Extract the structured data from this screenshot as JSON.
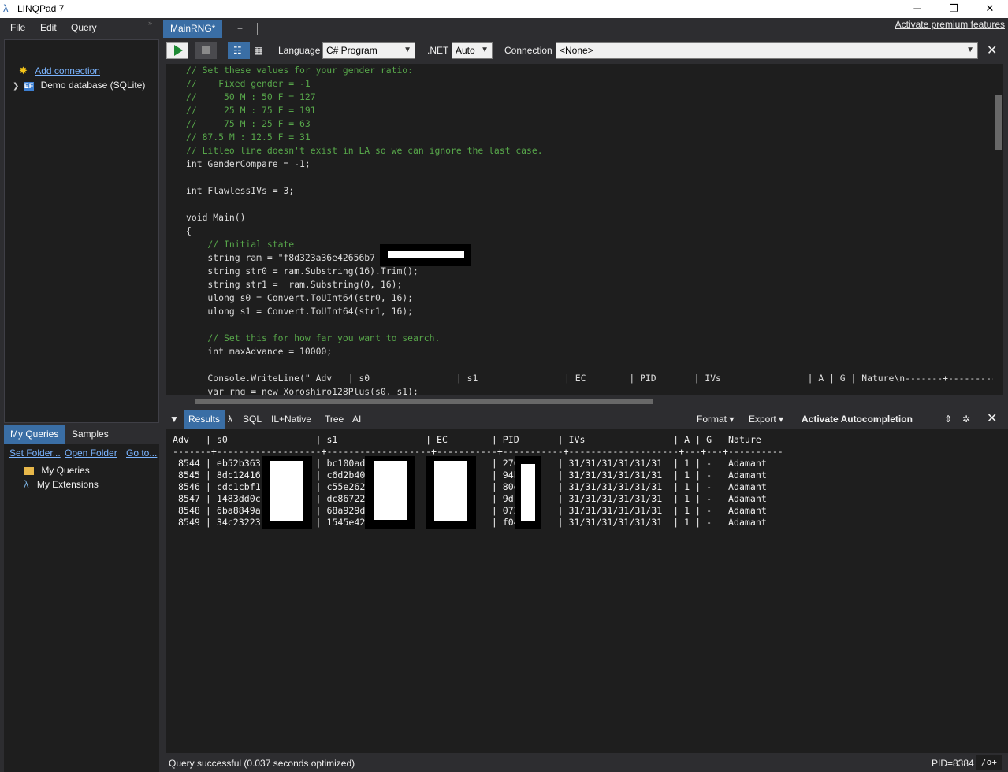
{
  "window": {
    "title": "LINQPad 7",
    "controls": {
      "minimize": "─",
      "maximize": "❐",
      "close": "✕"
    }
  },
  "menu": [
    "File",
    "Edit",
    "Query"
  ],
  "connections": {
    "add_connection": "Add connection",
    "items": [
      {
        "badge": "EF",
        "label": "Demo database (SQLite)"
      }
    ]
  },
  "lower_tabs": [
    "My Queries",
    "Samples"
  ],
  "folder_links": [
    "Set Folder...",
    "Open Folder",
    "Go to..."
  ],
  "query_tree": [
    "My Queries",
    "My Extensions"
  ],
  "doc_tabs": {
    "active": "MainRNG*",
    "new_tab": "+"
  },
  "premium_link": "Activate premium features",
  "toolbar": {
    "language_label": "Language",
    "language_value": "C# Program",
    "dotnet_label": ".NET",
    "dotnet_value": "Auto",
    "connection_label": "Connection",
    "connection_value": "<None>"
  },
  "code_lines": [
    "// Set these values for your gender ratio:",
    "//    Fixed gender = -1",
    "//     50 M : 50 F = 127",
    "//     25 M : 75 F = 191",
    "//     75 M : 25 F = 63",
    "// 87.5 M : 12.5 F = 31",
    "// Litleo line doesn't exist in LA so we can ignore the last case.",
    "int GenderCompare = -1;",
    "",
    "int FlawlessIVs = 3;",
    "",
    "void Main()",
    "{",
    "    // Initial state",
    "    string ram = \"f8d323a36e42656b7",
    "    string str0 = ram.Substring(16).Trim();",
    "    string str1 =  ram.Substring(0, 16);",
    "    ulong s0 = Convert.ToUInt64(str0, 16);",
    "    ulong s1 = Convert.ToUInt64(str1, 16);",
    "",
    "    // Set this for how far you want to search.",
    "    int maxAdvance = 10000;",
    "",
    "    Console.WriteLine(\" Adv   | s0                | s1                | EC        | PID       | IVs                | A | G | Nature\\n-------+-----------",
    "    var rng = new Xoroshiro128Plus(s0, s1);"
  ],
  "results_tabs": [
    "Results",
    "λ",
    "SQL",
    "IL+Native",
    "Tree",
    "AI"
  ],
  "results_actions": {
    "format": "Format",
    "export": "Export",
    "autocompletion": "Activate Autocompletion"
  },
  "results_header": "Adv   | s0                | s1                | EC        | PID       | IVs                | A | G | Nature",
  "results_separator": "-------+-------------------+-------------------+-----------+-----------+--------------------+---+---+----------",
  "results_rows": [
    " 8544 | eb52b363          | bc100ad2          |           | 2708      | 31/31/31/31/31/31  | 1 | - | Adamant",
    " 8545 | 8dc12416          | c6d2b40a          |           | 94b6      | 31/31/31/31/31/31  | 1 | - | Adamant",
    " 8546 | cdc1cbf1          | c55e2629          |           | 80d5      | 31/31/31/31/31/31  | 1 | - | Adamant",
    " 8547 | 1483dd0c          | dc867221          |           | 9d16      | 31/31/31/31/31/31  | 1 | - | Adamant",
    " 8548 | 6ba8849a          | 68a929d9          |           | 072f      | 31/31/31/31/31/31  | 1 | - | Adamant",
    " 8549 | 34c23223          | 1545e420          |           | f048      | 31/31/31/31/31/31  | 1 | - | Adamant"
  ],
  "status": {
    "message": "Query successful  (0.037 seconds optimized)",
    "pid": "PID=8384",
    "optimize": "/o+"
  }
}
